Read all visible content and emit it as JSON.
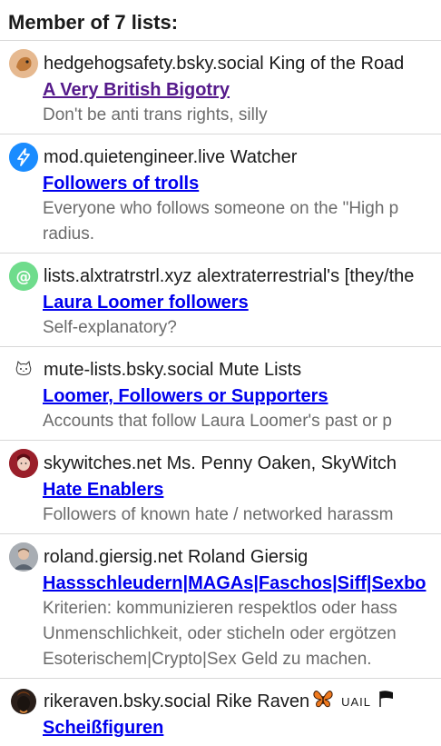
{
  "heading": "Member of 7 lists:",
  "lists": [
    {
      "handle": "hedgehogsafety.bsky.social",
      "owner": "King of the Road",
      "title": "A Very British Bigotry",
      "desc": [
        "Don't be anti trans rights, silly"
      ],
      "avatar": "hedgehog-avatar-icon",
      "visited": true
    },
    {
      "handle": "mod.quietengineer.live",
      "owner": "Watcher",
      "title": "Followers of trolls",
      "desc": [
        "Everyone who follows someone on the \"High p",
        "radius."
      ],
      "avatar": "lightning-avatar-icon"
    },
    {
      "handle": "lists.alxtratrstrl.xyz",
      "owner": "alextraterrestrial's [they/the",
      "title": "Laura Loomer followers",
      "desc": [
        "Self-explanatory?"
      ],
      "avatar": "at-sign-avatar-icon"
    },
    {
      "handle": "mute-lists.bsky.social",
      "owner": "Mute Lists",
      "title": "Loomer, Followers or Supporters",
      "desc": [
        "Accounts that follow Laura Loomer's past or p"
      ],
      "avatar": "cat-avatar-icon"
    },
    {
      "handle": "skywitches.net",
      "owner": "Ms. Penny Oaken, SkyWitch",
      "title": "Hate Enablers",
      "desc": [
        "Followers of known hate / networked harassm"
      ],
      "avatar": "witch-avatar-icon"
    },
    {
      "handle": "roland.giersig.net",
      "owner": "Roland Giersig",
      "title": "Hassschleudern|MAGAs|Faschos|Siff|Sexbo",
      "desc": [
        "Kriterien: kommunizieren respektlos oder hass",
        "Unmenschlichkeit, oder sticheln oder ergötzen",
        "Esoterischem|Crypto|Sex Geld zu machen."
      ],
      "avatar": "person-avatar-icon"
    },
    {
      "handle": "rikeraven.bsky.social",
      "owner": "Rike Raven",
      "badge": "UAIL",
      "title": "Scheißfiguren",
      "desc": [],
      "avatar": "raven-avatar-icon"
    }
  ]
}
